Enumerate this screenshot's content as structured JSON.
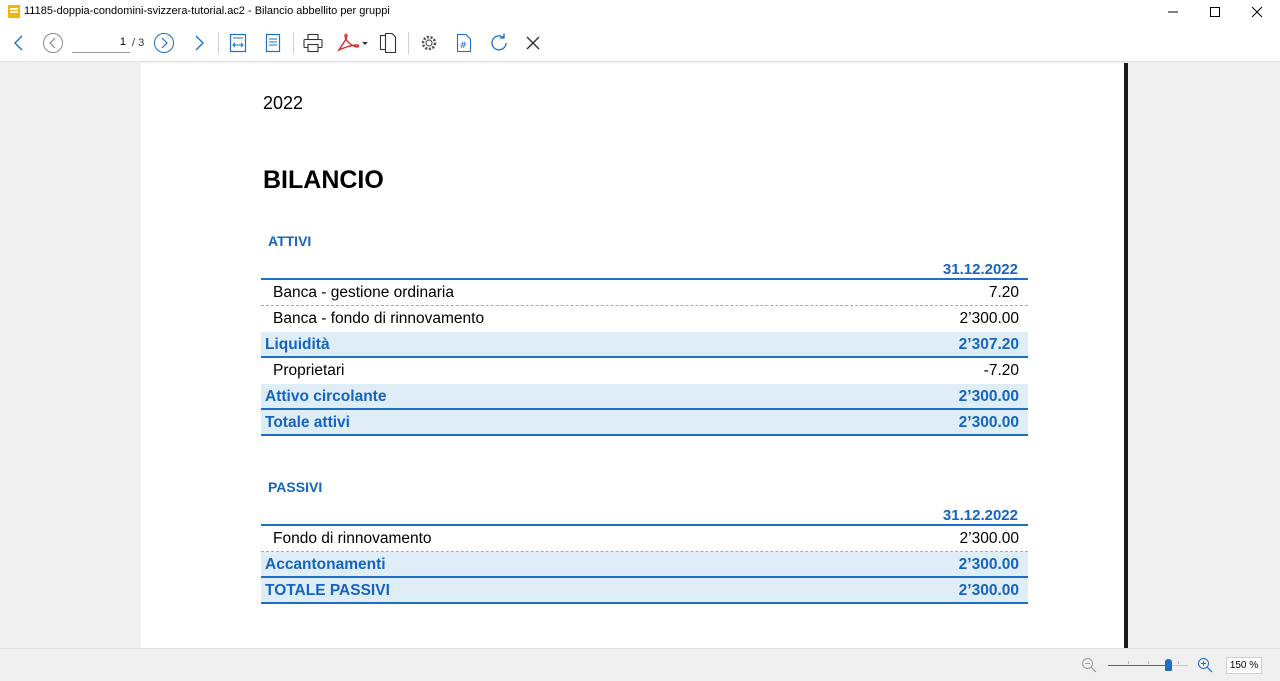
{
  "window": {
    "title": "11185-doppia-condomini-svizzera-tutorial.ac2 - Bilancio abbellito per gruppi"
  },
  "toolbar": {
    "current_page": "1",
    "page_total": "/ 3",
    "icons": [
      "back-arrow",
      "prev-page",
      "next-page",
      "forward-arrow",
      "fit-width",
      "fit-page",
      "print",
      "pdf-export",
      "copy-pages",
      "settings",
      "page-number",
      "refresh",
      "close"
    ]
  },
  "document": {
    "year": "2022",
    "title": "BILANCIO",
    "attivi": {
      "heading": "ATTIVI",
      "date": "31.12.2022",
      "rows": [
        {
          "label": "Banca - gestione ordinaria",
          "value": "7.20"
        },
        {
          "label": "Banca - fondo di rinnovamento",
          "value": "2’300.00"
        },
        {
          "label": "Liquidità",
          "value": "2’307.20"
        },
        {
          "label": "Proprietari",
          "value": "-7.20"
        },
        {
          "label": "Attivo circolante",
          "value": "2’300.00"
        },
        {
          "label": "Totale attivi",
          "value": "2’300.00"
        }
      ]
    },
    "passivi": {
      "heading": "PASSIVI",
      "date": "31.12.2022",
      "rows": [
        {
          "label": "Fondo di rinnovamento",
          "value": "2’300.00"
        },
        {
          "label": "Accantonamenti",
          "value": "2’300.00"
        },
        {
          "label": "TOTALE PASSIVI",
          "value": "2’300.00"
        }
      ]
    }
  },
  "statusbar": {
    "zoom": "150 %",
    "zoom_level_fraction": 0.75
  },
  "colors": {
    "accent": "#1565c0",
    "total_row_bg": "#deedf6",
    "rule": "#1e6fc9"
  }
}
